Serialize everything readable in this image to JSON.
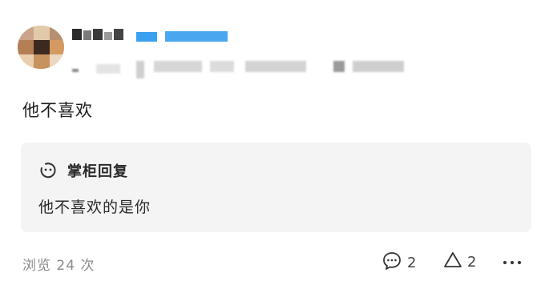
{
  "user": {
    "avatar_icon": "avatar-pixelated",
    "name_blurred": true,
    "meta_blurred": true
  },
  "post": {
    "text": "他不喜欢"
  },
  "reply": {
    "icon": "smile-face-icon",
    "title": "掌柜回复",
    "text": "他不喜欢的是你"
  },
  "footer": {
    "views_text": "浏览 24 次",
    "comment_icon": "comment-bubble-icon",
    "comment_count": "2",
    "like_icon": "triangle-up-icon",
    "like_count": "2",
    "more_icon": "more-dots-icon"
  },
  "colors": {
    "accent_blue": "#3ba0ef",
    "reply_bg": "#f4f4f5",
    "muted_text": "#8a8a8a"
  }
}
